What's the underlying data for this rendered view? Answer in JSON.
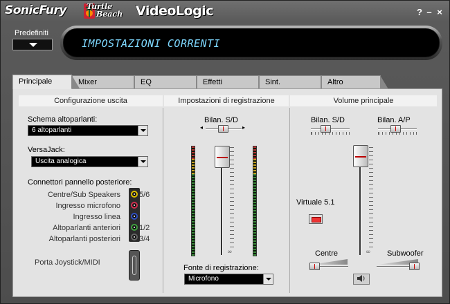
{
  "titlebar": {
    "brand_sonic": "SonicFury",
    "brand_turtle_1": "Turtle",
    "brand_turtle_2": "Beach",
    "brand_video": "VideoLogic",
    "help": "?",
    "minimize": "–",
    "close": "×"
  },
  "preset": {
    "label": "Predefiniti"
  },
  "lcd": {
    "text": "IMPOSTAZIONI CORRENTI"
  },
  "tabs": [
    "Principale",
    "Mixer",
    "EQ",
    "Effetti",
    "Sint.",
    "Altro"
  ],
  "output": {
    "heading": "Configurazione uscita",
    "speaker_scheme_label": "Schema altoparlanti:",
    "speaker_scheme_value": "6 altoparlanti",
    "versajack_label": "VersaJack:",
    "versajack_value": "Uscita analogica",
    "connectors_label": "Connettori pannello posteriore:",
    "connectors": [
      {
        "name": "Centre/Sub Speakers",
        "count": "5/6",
        "color": "#e0c000"
      },
      {
        "name": "Ingresso microfono",
        "count": "",
        "color": "#d03050"
      },
      {
        "name": "Ingresso linea",
        "count": "",
        "color": "#3050c0"
      },
      {
        "name": "Altoparlanti anteriori",
        "count": "1/2",
        "color": "#40a040"
      },
      {
        "name": "Altoparlanti posteriori",
        "count": "3/4",
        "color": "#222222"
      }
    ],
    "joystick_label": "Porta Joystick/MIDI"
  },
  "recording": {
    "heading": "Impostazioni di registrazione",
    "balance_label": "Bilan. S/D",
    "source_label": "Fonte di registrazione:",
    "source_value": "Microfono",
    "inf": "∞"
  },
  "volume": {
    "heading": "Volume principale",
    "balance_lr_label": "Bilan. S/D",
    "balance_fr_label": "Bilan. A/P",
    "virtual_label": "Virtuale 5.1",
    "centre_label": "Centre",
    "subwoofer_label": "Subwoofer",
    "inf": "∞",
    "speaker_icon": "speaker-icon"
  }
}
